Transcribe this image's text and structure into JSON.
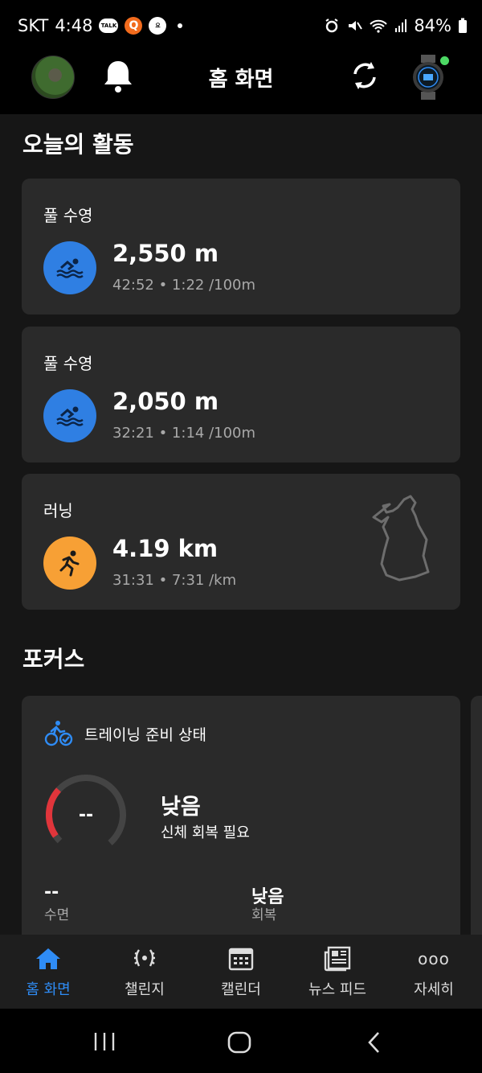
{
  "status_bar": {
    "carrier": "SKT",
    "time": "4:48",
    "talk_badge": "TALK",
    "q_badge": "Q",
    "w_badge": "요",
    "battery": "84%"
  },
  "header": {
    "title": "홈 화면"
  },
  "today": {
    "section_title": "오늘의 활동",
    "activities": [
      {
        "type": "풀 수영",
        "metric": "2,550 m",
        "detail": "42:52 • 1:22 /100m",
        "icon": "swim-icon",
        "color": "#2f7fe3"
      },
      {
        "type": "풀 수영",
        "metric": "2,050 m",
        "detail": "32:21 • 1:14 /100m",
        "icon": "swim-icon",
        "color": "#2f7fe3"
      },
      {
        "type": "러닝",
        "metric": "4.19 km",
        "detail": "31:31 • 7:31 /km",
        "icon": "run-icon",
        "color": "#f7a035"
      }
    ]
  },
  "focus": {
    "section_title": "포커스",
    "card_title": "트레이닝 준비 상태",
    "gauge_value": "--",
    "status": "낮음",
    "status_sub": "신체 회복 필요",
    "stats": [
      {
        "value": "--",
        "label": "수면"
      },
      {
        "value": "낮음",
        "label": "회복"
      }
    ]
  },
  "nav": {
    "items": [
      {
        "label": "홈 화면",
        "icon": "home-icon"
      },
      {
        "label": "챌린지",
        "icon": "laurel-icon"
      },
      {
        "label": "캘린더",
        "icon": "calendar-icon"
      },
      {
        "label": "뉴스 피드",
        "icon": "newsfeed-icon"
      },
      {
        "label": "자세히",
        "icon": "more-icon"
      }
    ],
    "more_glyph": "ooo"
  },
  "colors": {
    "accent": "#2f8cf5",
    "swim": "#2f7fe3",
    "run": "#f7a035",
    "gauge_low": "#e0353b",
    "online": "#4cd964"
  }
}
